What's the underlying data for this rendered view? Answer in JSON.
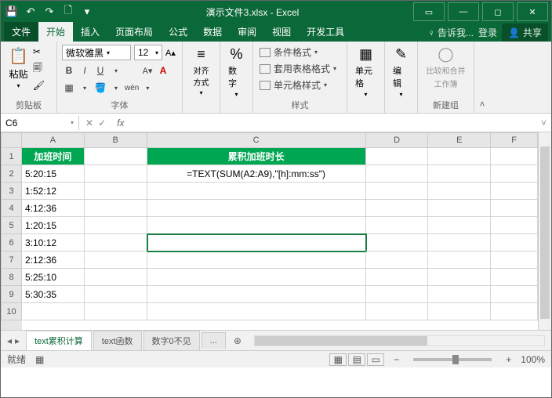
{
  "title": "演示文件3.xlsx - Excel",
  "qat": {
    "save": "💾",
    "undo": "↶",
    "redo": "↷",
    "new": "🗋"
  },
  "tabs": {
    "file": "文件",
    "home": "开始",
    "insert": "插入",
    "layout": "页面布局",
    "formulas": "公式",
    "data": "数据",
    "review": "审阅",
    "view": "视图",
    "dev": "开发工具",
    "tell": "告诉我...",
    "login": "登录",
    "share": "共享"
  },
  "ribbon": {
    "clipboard": {
      "paste": "粘贴",
      "label": "剪贴板"
    },
    "font": {
      "name": "微软雅黑",
      "size": "12",
      "label": "字体"
    },
    "align": {
      "label": "对齐方式"
    },
    "number": {
      "percent": "%",
      "label": "数字"
    },
    "styles": {
      "cond": "条件格式",
      "table": "套用表格格式",
      "cell": "单元格样式",
      "label": "样式"
    },
    "cells": {
      "label": "单元格"
    },
    "edit": {
      "label": "编辑"
    },
    "compare": {
      "line1": "比较和合并",
      "line2": "工作簿",
      "label": "新建组"
    }
  },
  "namebox": "C6",
  "fx": "fx",
  "colheads": [
    "A",
    "B",
    "C",
    "D",
    "E",
    "F"
  ],
  "rows": [
    "1",
    "2",
    "3",
    "4",
    "5",
    "6",
    "7",
    "8",
    "9",
    "10"
  ],
  "data": {
    "a_header": "加班时间",
    "c_header": "累积加班时长",
    "a": [
      "5:20:15",
      "1:52:12",
      "4:12:36",
      "1:20:15",
      "3:10:12",
      "2:12:36",
      "5:25:10",
      "5:30:35"
    ],
    "c2": "=TEXT(SUM(A2:A9),\"[h]:mm:ss\")"
  },
  "sheets": {
    "s1": "text累积计算",
    "s2": "text函数",
    "s3": "数字0不见",
    "more": "..."
  },
  "status": {
    "ready": "就绪",
    "zoom": "100%"
  }
}
